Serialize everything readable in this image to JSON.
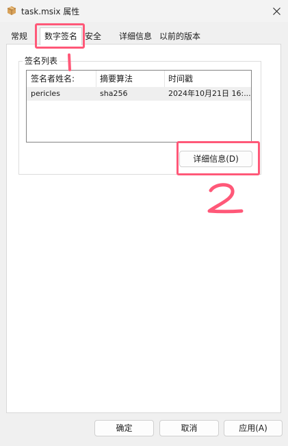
{
  "window": {
    "title": "task.msix 属性",
    "icon": "package-icon",
    "close_icon": "close-icon"
  },
  "tabs": [
    {
      "label": "常规"
    },
    {
      "label": "数字签名",
      "selected": true
    },
    {
      "label": "安全"
    },
    {
      "label": "详细信息"
    },
    {
      "label": "以前的版本"
    }
  ],
  "signature_list": {
    "group_label": "签名列表",
    "columns": [
      "签名者姓名:",
      "摘要算法",
      "时间戳"
    ],
    "rows": [
      {
        "signer": "pericles",
        "digest": "sha256",
        "timestamp": "2024年10月21日 16:..."
      }
    ]
  },
  "buttons": {
    "details": "详细信息(D)",
    "ok": "确定",
    "cancel": "取消",
    "apply": "应用(A)"
  },
  "annotations": {
    "step1": "1",
    "step2": "2",
    "color": "#ff5878"
  },
  "colors": {
    "annotation": "#ff5878",
    "selected_row": "#efefef",
    "background": "#f0f0f0"
  }
}
